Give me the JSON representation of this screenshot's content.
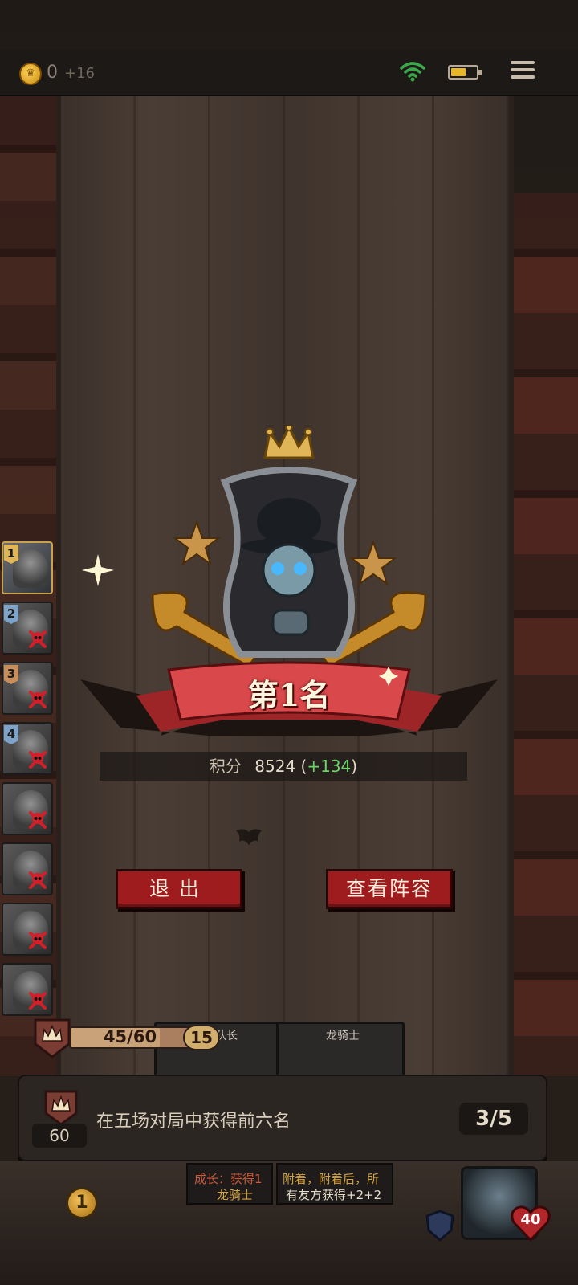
{
  "topbar": {
    "coin_value": "0",
    "coin_increment": "+16",
    "battery_level": 0.6
  },
  "ranking": {
    "entries": [
      {
        "rank": "1",
        "eliminated": false
      },
      {
        "rank": "2",
        "eliminated": true
      },
      {
        "rank": "3",
        "eliminated": true
      },
      {
        "rank": "4",
        "eliminated": true
      },
      {
        "rank": "",
        "eliminated": true
      },
      {
        "rank": "",
        "eliminated": true
      },
      {
        "rank": "",
        "eliminated": true
      },
      {
        "rank": "",
        "eliminated": true
      }
    ]
  },
  "result": {
    "place_label": "第1名",
    "score_label": "积分",
    "score_value": "8524",
    "score_gain": "+134",
    "paren_open": "(",
    "paren_close": ")"
  },
  "buttons": {
    "exit": "退出",
    "view_lineup": "查看阵容"
  },
  "progress": {
    "xp": "45/60",
    "xp_fraction": 0.75,
    "level_badge": "15"
  },
  "cards": {
    "card1_title": "士队长",
    "card2_title": "龙骑士",
    "card1_desc_line1": "成长：获得1",
    "card1_desc_line2": "龙骑士",
    "card2_desc_line1": "附着，附着后，所",
    "card2_desc_line2": "有友方获得+2+2"
  },
  "quest": {
    "level": "60",
    "description": "在五场对局中获得前六名",
    "progress": "3/5"
  },
  "bottom": {
    "gold": "1",
    "hp": "40"
  },
  "colors": {
    "button_red": "#9e1b1e",
    "banner_red": "#d9484a",
    "gold": "#e0b557",
    "score_gain_green": "#6bd46b"
  }
}
